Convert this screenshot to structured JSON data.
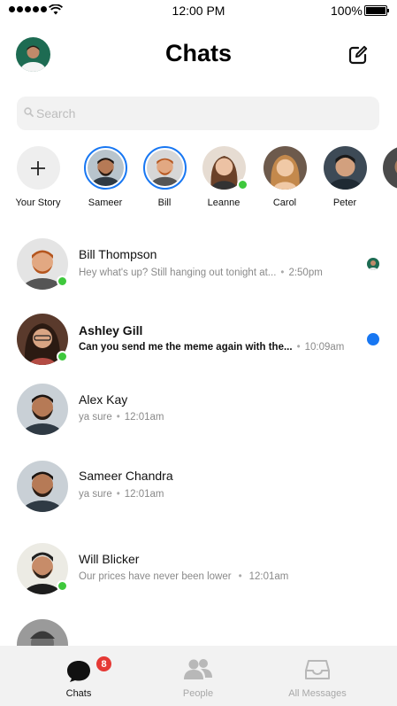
{
  "status_bar": {
    "time": "12:00 PM",
    "battery": "100%"
  },
  "header": {
    "title": "Chats",
    "icons": {
      "compose": "compose-icon",
      "profile": "avatar"
    }
  },
  "search": {
    "placeholder": "Search",
    "icon": "search-icon"
  },
  "stories": [
    {
      "label": "Your Story",
      "kind": "add"
    },
    {
      "label": "Sameer",
      "kind": "active"
    },
    {
      "label": "Bill",
      "kind": "active"
    },
    {
      "label": "Leanne",
      "kind": "online"
    },
    {
      "label": "Carol",
      "kind": "plain"
    },
    {
      "label": "Peter",
      "kind": "plain"
    }
  ],
  "chats": [
    {
      "name": "Bill Thompson",
      "preview": "Hey what's up? Still hanging out tonight at...",
      "time": "2:50pm",
      "unread": false,
      "online": true,
      "status": "seen"
    },
    {
      "name": "Ashley Gill",
      "preview": "Can you send me the meme again with the...",
      "time": "10:09am",
      "unread": true,
      "online": true,
      "status": "unread"
    },
    {
      "name": "Alex Kay",
      "preview": "ya sure",
      "time": "12:01am",
      "unread": false,
      "online": false,
      "status": "none"
    },
    {
      "name": "Sameer Chandra",
      "preview": "ya sure",
      "time": "12:01am",
      "unread": false,
      "online": false,
      "status": "none"
    },
    {
      "name": "Will Blicker",
      "preview": "Our prices have never been lower",
      "time": "12:01am",
      "unread": false,
      "online": true,
      "status": "none"
    }
  ],
  "tabs": [
    {
      "label": "Chats",
      "icon": "chat-bubble-icon",
      "active": true,
      "badge": "8"
    },
    {
      "label": "People",
      "icon": "people-icon",
      "active": false
    },
    {
      "label": "All Messages",
      "icon": "inbox-icon",
      "active": false
    }
  ],
  "colors": {
    "accent": "#1877f2",
    "online": "#3ec83c",
    "badge": "#e53935"
  }
}
